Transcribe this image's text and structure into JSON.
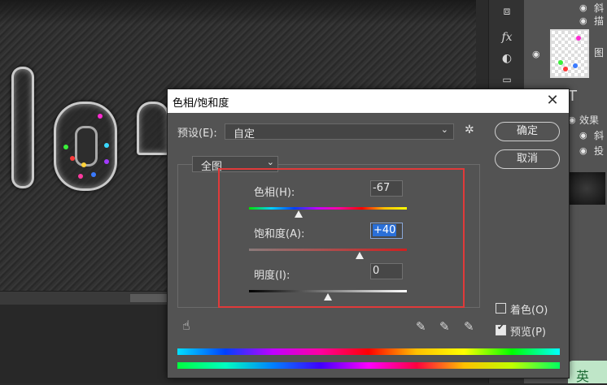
{
  "dialog": {
    "title": "色相/饱和度",
    "close": "✕",
    "preset_label": "预设(E):",
    "preset_value": "自定",
    "ok": "确定",
    "cancel": "取消",
    "channel": "全图",
    "hue_label": "色相(H):",
    "hue_value": "-67",
    "saturation_label": "饱和度(A):",
    "saturation_value": "+40",
    "lightness_label": "明度(I):",
    "lightness_value": "0",
    "colorize_label": "着色(O)",
    "preview_label": "预览(P)",
    "preview_checked": true,
    "colorize_checked": false
  },
  "layers": {
    "row1": "斜",
    "row2": "描",
    "row3": "图",
    "row4": "效果",
    "row5": "斜",
    "row6": "投"
  },
  "sliders": {
    "hue": -67,
    "saturation": 40,
    "lightness": 0
  },
  "canvas": {
    "text": "lov"
  },
  "badge": "英"
}
